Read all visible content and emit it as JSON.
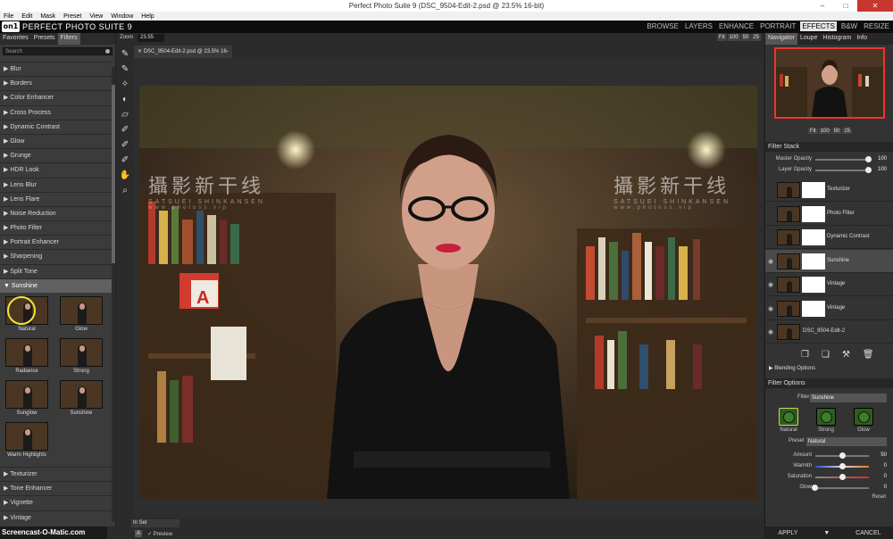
{
  "window": {
    "title": "Perfect Photo Suite 9 (DSC_9504-Edit-2.psd @ 23.5% 16-bit)"
  },
  "menu": [
    "File",
    "Edit",
    "Mask",
    "Preset",
    "View",
    "Window",
    "Help"
  ],
  "app": {
    "logo": "on1",
    "name": "PERFECT PHOTO SUITE 9"
  },
  "modules": [
    "BROWSE",
    "LAYERS",
    "ENHANCE",
    "PORTRAIT",
    "EFFECTS",
    "B&W",
    "RESIZE"
  ],
  "active_module": "EFFECTS",
  "left_panel": {
    "tabs": [
      "Favorites",
      "Presets",
      "Filters"
    ],
    "search_placeholder": "Search",
    "categories_top": [
      "Blur",
      "Borders",
      "Color Enhancer",
      "Cross Process",
      "Dynamic Contrast",
      "Glow",
      "Grunge",
      "HDR Look",
      "Lens Blur",
      "Lens Flare",
      "Noise Reduction",
      "Photo Filter",
      "Portrait Enhancer",
      "Sharpening",
      "Split Tone"
    ],
    "open_category": "Sunshine",
    "presets": [
      "Natural",
      "Glow",
      "Radiance",
      "Strong",
      "Sunglow",
      "Sunshine",
      "Warm Highlights"
    ],
    "categories_bottom": [
      "Texturizer",
      "Tone Enhancer",
      "Vignette",
      "Vintage"
    ]
  },
  "zoom": {
    "label": "Zoom",
    "value": "23.55",
    "buttons": [
      "Fit",
      "100",
      "50",
      "25"
    ]
  },
  "document_tab": "DSC_9504-Edit-2.psd @ 23.5% 16-bit",
  "canvas_watermark": {
    "cn": "攝影新干线",
    "en": "SATSUEI SHINKANSEN",
    "url": "www.photoss.vip"
  },
  "bottom_bar": {
    "view_select": "In Sel",
    "preview_label": "Preview"
  },
  "recorder_watermark": "Screencast-O-Matic.com",
  "right_panel": {
    "tabs": [
      "Navigator",
      "Loupe",
      "Histogram",
      "Info"
    ],
    "nav_buttons": [
      "Fit",
      "100",
      "50",
      "25"
    ],
    "filter_stack": {
      "title": "Filter Stack",
      "master_opacity_label": "Master Opacity",
      "master_opacity_value": "100",
      "layer_opacity_label": "Layer Opacity",
      "layer_opacity_value": "100",
      "layers": [
        "Texturizer",
        "Photo Filter",
        "Dynamic Contrast",
        "Sunshine",
        "Vintage",
        "Vintage",
        "DSC_9504-Edit-2"
      ],
      "selected_layer": "Sunshine",
      "blending_label": "Blending Options"
    },
    "filter_options": {
      "title": "Filter Options",
      "filter_label": "Filter",
      "filter_value": "Sunshine",
      "preset_thumbs": [
        "Natural",
        "Strong",
        "Glow"
      ],
      "preset_label": "Preset",
      "preset_value": "Natural",
      "sliders": [
        {
          "label": "Amount",
          "value": "50"
        },
        {
          "label": "Warmth",
          "value": "0"
        },
        {
          "label": "Saturation",
          "value": "0"
        },
        {
          "label": "Glow",
          "value": "0"
        }
      ],
      "reset_label": "Reset"
    },
    "apply_label": "APPLY",
    "cancel_label": "CANCEL"
  }
}
